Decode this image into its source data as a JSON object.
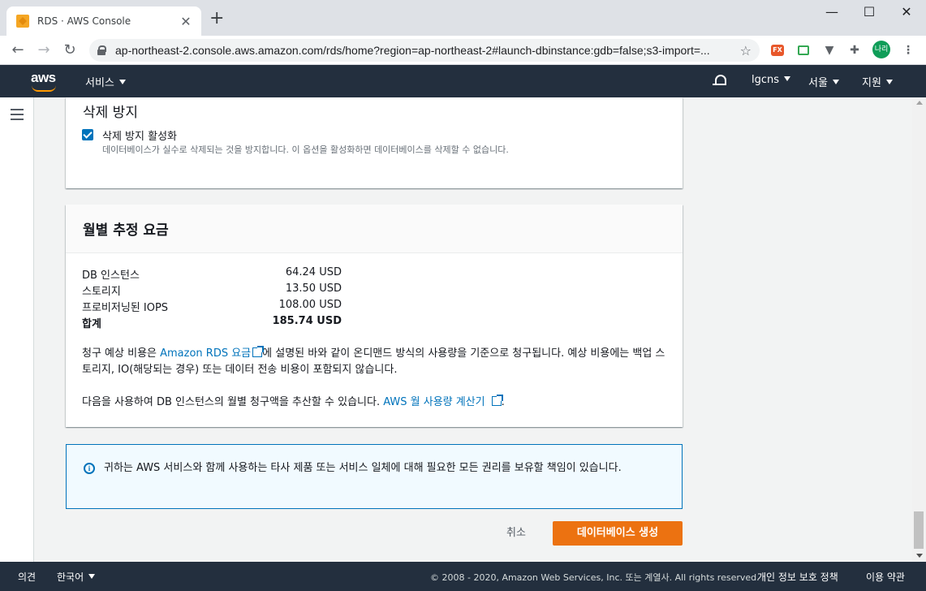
{
  "browser": {
    "tab_title": "RDS · AWS Console",
    "tab_close": "✕",
    "new_tab": "+",
    "url": "ap-northeast-2.console.aws.amazon.com/rds/home?region=ap-northeast-2#launch-dbinstance:gdb=false;s3-import=...",
    "window": {
      "minimize": "—",
      "maximize": "☐",
      "close": "✕"
    },
    "profile": "나리",
    "ext_fx": "FX"
  },
  "aws_nav": {
    "logo": "aws",
    "services": "서비스",
    "account": "lgcns",
    "region": "서울",
    "support": "지원"
  },
  "deletion_protection": {
    "title": "삭제 방지",
    "checkbox_label": "삭제 방지 활성화",
    "checked": true,
    "description": "데이터베이스가 실수로 삭제되는 것을 방지합니다. 이 옵션을 활성화하면 데이터베이스를 삭제할 수 없습니다."
  },
  "monthly_cost": {
    "title": "월별 추정 요금",
    "rows": [
      {
        "label": "DB 인스턴스",
        "value": "64.24 USD"
      },
      {
        "label": "스토리지",
        "value": "13.50 USD"
      },
      {
        "label": "프로비저닝된 IOPS",
        "value": "108.00 USD"
      }
    ],
    "total": {
      "label": "합계",
      "value": "185.74 USD"
    },
    "para1_before": "청구 예상 비용은 ",
    "para1_link": "Amazon RDS 요금",
    "para1_after": "에 설명된 바와 같이 온디맨드 방식의 사용량을 기준으로 청구됩니다. 예상 비용에는 백업 스토리지, IO(해당되는 경우) 또는 데이터 전송 비용이 포함되지 않습니다.",
    "para2_before": "다음을 사용하여 DB 인스턴스의 월별 청구액을 추산할 수 있습니다. ",
    "para2_link": "AWS 월 사용량 계산기",
    "para2_after": "."
  },
  "info": {
    "text": "귀하는 AWS 서비스와 함께 사용하는 타사 제품 또는 서비스 일체에 대해 필요한 모든 권리를 보유할 책임이 있습니다."
  },
  "actions": {
    "cancel": "취소",
    "create": "데이터베이스 생성"
  },
  "footer": {
    "feedback": "의견",
    "language": "한국어",
    "copyright": "© 2008 - 2020, Amazon Web Services, Inc. 또는 계열사. All rights reserved.",
    "privacy": "개인 정보 보호 정책",
    "terms": "이용 약관"
  },
  "colors": {
    "aws_nav_bg": "#232f3e",
    "primary_button": "#ec7211",
    "link": "#0073bb",
    "info_bg": "#f1faff"
  }
}
